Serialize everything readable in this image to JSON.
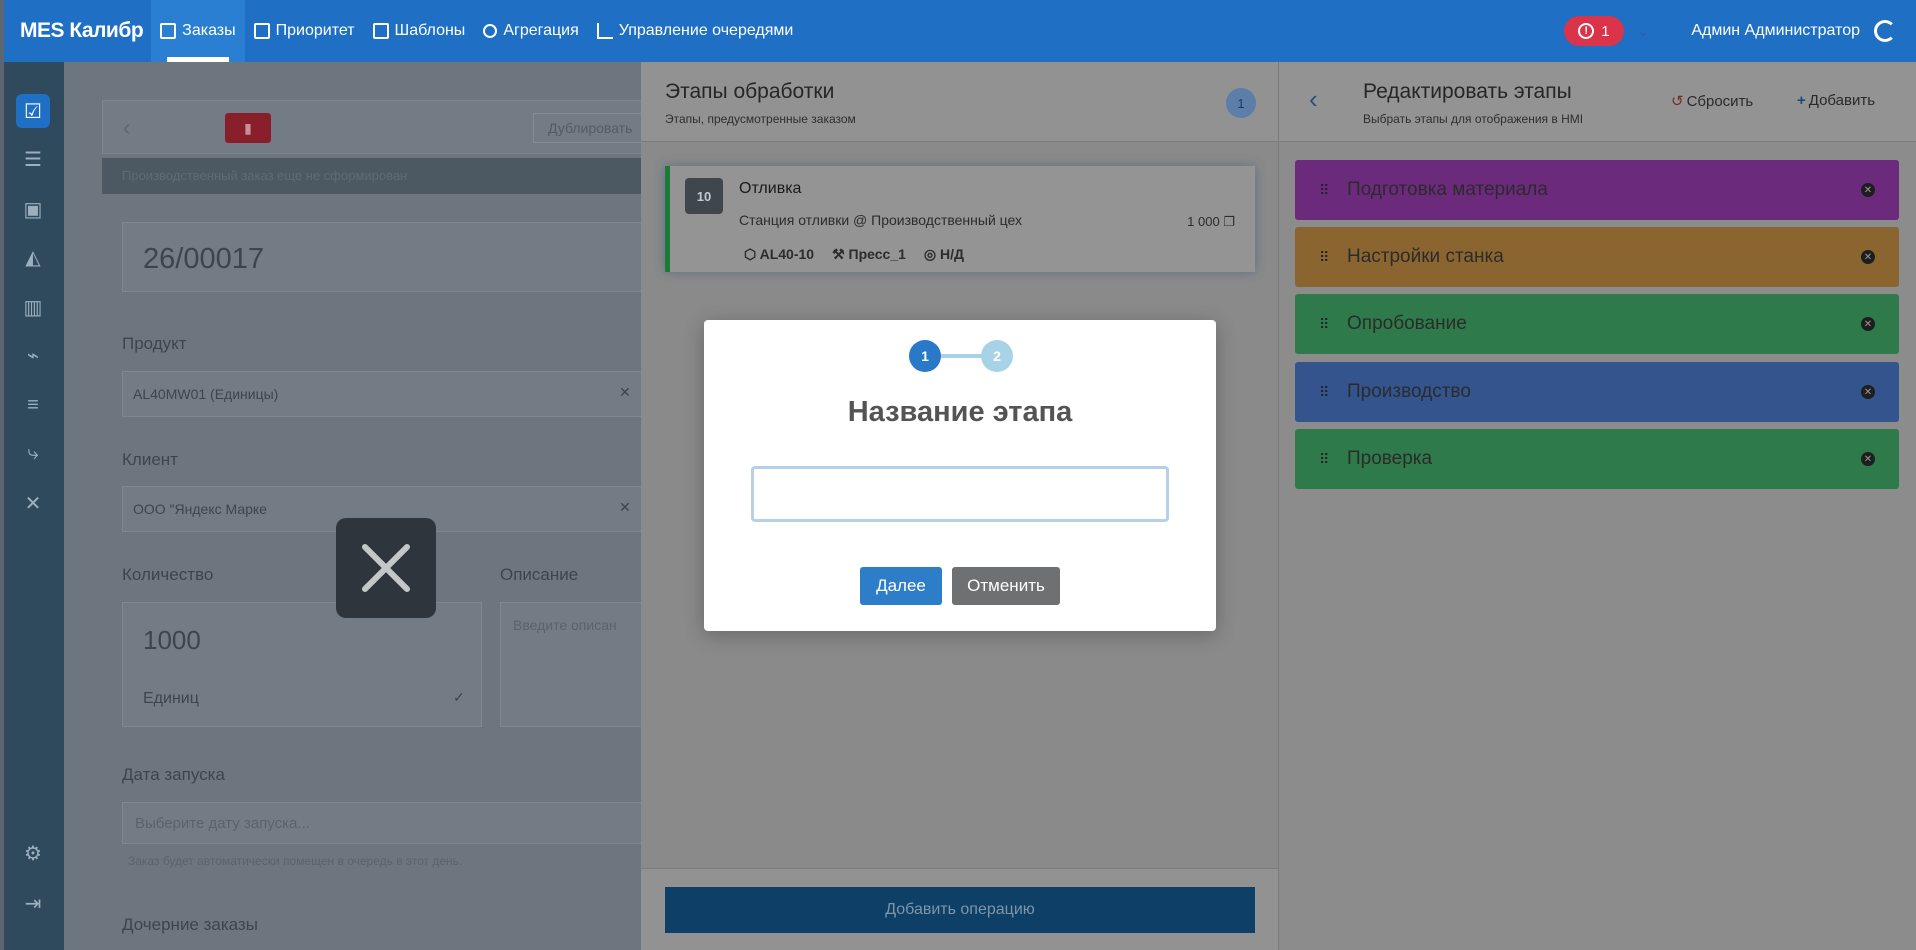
{
  "app": {
    "brand": "MES Калибр"
  },
  "nav": [
    {
      "label": "Заказы",
      "icon": "book-icon",
      "active": true
    },
    {
      "label": "Приоритет",
      "icon": "list-priority-icon"
    },
    {
      "label": "Шаблоны",
      "icon": "template-icon"
    },
    {
      "label": "Агрегация",
      "icon": "sitemap-icon"
    },
    {
      "label": "Управление очередями",
      "icon": "queue-chart-icon"
    }
  ],
  "header": {
    "alert_count": "1",
    "user_name": "Админ Администратор"
  },
  "sidebar": {
    "items": [
      "orders-icon",
      "priority-icon",
      "save-icon",
      "area-chart-icon",
      "bar-chart-icon",
      "line-chart-icon",
      "list-icon",
      "flow-icon",
      "tools-icon",
      "settings-icon",
      "logout-icon"
    ]
  },
  "order_form": {
    "toolbar_duplicate": "Дублировать",
    "warning": "Производственный заказ еще не сформирован",
    "order_number": "26/00017",
    "product_label": "Продукт",
    "product_value": "AL40MW01 (Единицы)",
    "client_label": "Клиент",
    "client_value": "ООО \"Яндекс Марке",
    "quantity_label": "Количество",
    "quantity_value": "1000",
    "quantity_unit": "Единиц",
    "description_label": "Описание",
    "description_placeholder": "Введите описан",
    "start_date_label": "Дата запуска",
    "start_date_placeholder": "Выберите дату запуска...",
    "start_date_hint": "Заказ будет автоматически помещен в очередь в этот день.",
    "child_orders_label": "Дочерние заказы"
  },
  "processing": {
    "title": "Этапы обработки",
    "subtitle": "Этапы, предусмотренные заказом",
    "badge": "1",
    "operation": {
      "number": "10",
      "name": "Отливка",
      "station": "Станция отливки @ Производственный цех",
      "quantity": "1 000",
      "material": "AL40-10",
      "machine": "Пресс_1",
      "tool": "Н/Д"
    },
    "add_button": "Добавить операцию"
  },
  "edit_stages": {
    "title": "Редактировать этапы",
    "subtitle": "Выбрать этапы для отображения в HMI",
    "reset_label": "Сбросить",
    "add_label": "Добавить",
    "stages": [
      {
        "name": "Подготовка материала",
        "color": "#6c2a7c"
      },
      {
        "name": "Настройки станка",
        "color": "#8a6530"
      },
      {
        "name": "Опробование",
        "color": "#2e7a4a"
      },
      {
        "name": "Производство",
        "color": "#34548e"
      },
      {
        "name": "Проверка",
        "color": "#2e7a4a"
      }
    ]
  },
  "modal": {
    "step1": "1",
    "step2": "2",
    "title": "Название этапа",
    "input_value": "",
    "next_label": "Далее",
    "cancel_label": "Отменить"
  }
}
